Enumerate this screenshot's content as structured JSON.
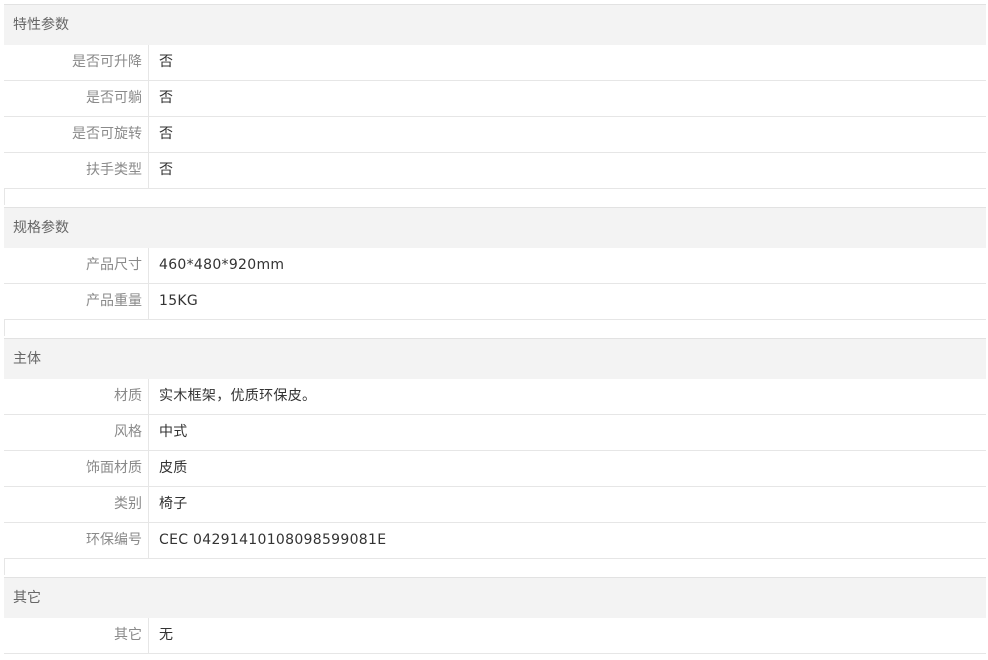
{
  "groups": [
    {
      "title": "特性参数",
      "rows": [
        {
          "label": "是否可升降",
          "value": "否"
        },
        {
          "label": "是否可躺",
          "value": "否"
        },
        {
          "label": "是否可旋转",
          "value": "否"
        },
        {
          "label": "扶手类型",
          "value": "否"
        }
      ]
    },
    {
      "title": "规格参数",
      "rows": [
        {
          "label": "产品尺寸",
          "value": "460*480*920mm"
        },
        {
          "label": "产品重量",
          "value": "15KG"
        }
      ]
    },
    {
      "title": "主体",
      "rows": [
        {
          "label": "材质",
          "value": "实木框架，优质环保皮。"
        },
        {
          "label": "风格",
          "value": "中式"
        },
        {
          "label": "饰面材质",
          "value": "皮质"
        },
        {
          "label": "类别",
          "value": "椅子"
        },
        {
          "label": "环保编号",
          "value": "CEC 04291410108098599081E"
        }
      ]
    },
    {
      "title": "其它",
      "rows": [
        {
          "label": "其它",
          "value": "无"
        }
      ]
    }
  ]
}
